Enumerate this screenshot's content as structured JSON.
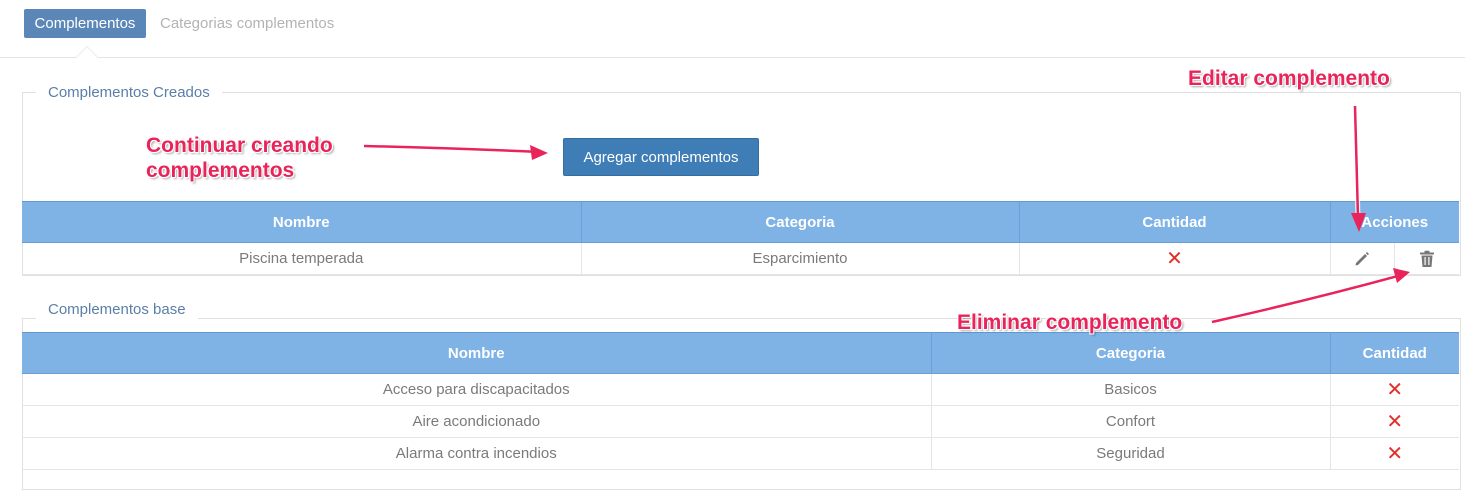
{
  "tabs": [
    {
      "label": "Complementos",
      "active": true
    },
    {
      "label": "Categorias complementos",
      "active": false
    }
  ],
  "created": {
    "legend": "Complementos Creados",
    "add_button": "Agregar complementos",
    "headers": [
      "Nombre",
      "Categoria",
      "Cantidad",
      "Acciones"
    ],
    "rows": [
      {
        "nombre": "Piscina temperada",
        "categoria": "Esparcimiento",
        "cantidad": "✕",
        "actions": [
          "pencil-icon",
          "trash-icon"
        ]
      }
    ]
  },
  "base": {
    "legend": "Complementos base",
    "headers": [
      "Nombre",
      "Categoria",
      "Cantidad"
    ],
    "rows": [
      {
        "nombre": "Acceso para discapacitados",
        "categoria": "Basicos",
        "cantidad": "✕"
      },
      {
        "nombre": "Aire acondicionado",
        "categoria": "Confort",
        "cantidad": "✕"
      },
      {
        "nombre": "Alarma contra incendios",
        "categoria": "Seguridad",
        "cantidad": "✕"
      }
    ]
  },
  "annotations": {
    "continue": [
      "Continuar creando",
      "complementos"
    ],
    "edit": "Editar complemento",
    "delete": "Eliminar complemento"
  },
  "colors": {
    "tab_active": "#5b87b8",
    "button": "#3e7db5",
    "table_header": "#7fb2e5",
    "x_mark": "#e0302a",
    "annotation": "#e8245a"
  }
}
